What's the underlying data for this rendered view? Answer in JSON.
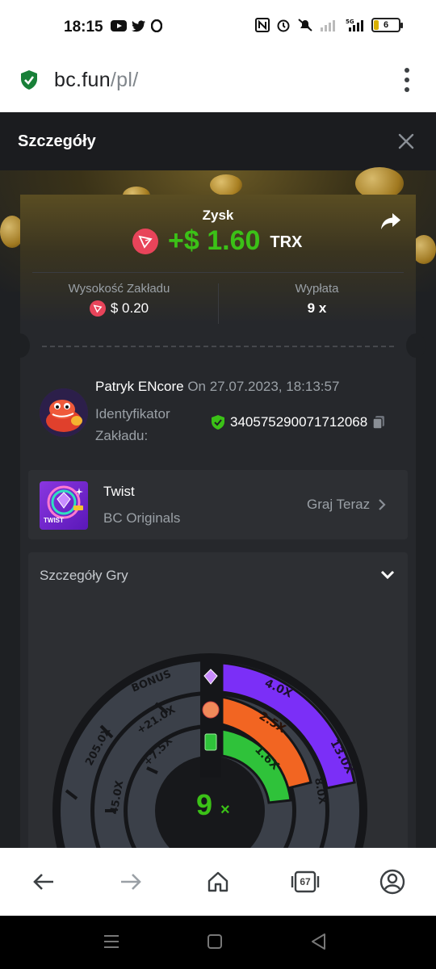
{
  "status_bar": {
    "time": "18:15",
    "battery": "6",
    "network": "5G"
  },
  "browser": {
    "url_host": "bc.fun",
    "url_path": "/pl/",
    "tabs_count": "67"
  },
  "modal": {
    "title": "Szczegóły"
  },
  "bet": {
    "profit_label": "Zysk",
    "profit_amount": "+$ 1.60",
    "currency": "TRX",
    "wager_label": "Wysokość Zakładu",
    "wager_value": "$ 0.20",
    "payout_label": "Wypłata",
    "payout_value": "9 x",
    "player_name": "Patryk ENcore",
    "placed_on": "On 27.07.2023, 18:13:57",
    "bet_id_label": "Identyfikator Zakładu:",
    "bet_id": "340575290071712068"
  },
  "game": {
    "name": "Twist",
    "provider": "BC Originals",
    "play_now": "Graj Teraz",
    "thumb_text": "TWIST"
  },
  "game_details": {
    "title": "Szczegóły Gry",
    "center_multiplier": "9",
    "center_suffix": "×",
    "ring_labels": {
      "outer_purple": "4.0X",
      "outer_purple_2": "13.0X",
      "middle_orange": "2.5X",
      "inner_green": "1.6X",
      "bonus": "BONUS",
      "plus_21": "+21.0X",
      "plus_7_5": "+7.5X",
      "x205": "205.0X",
      "x45": "45.0X",
      "x8": "8.0X"
    }
  },
  "colors": {
    "profit_green": "#3bc117",
    "trx_red": "#e8445a",
    "ring_purple": "#7b2ff7",
    "ring_orange": "#f26522",
    "ring_green": "#2fc23a"
  }
}
